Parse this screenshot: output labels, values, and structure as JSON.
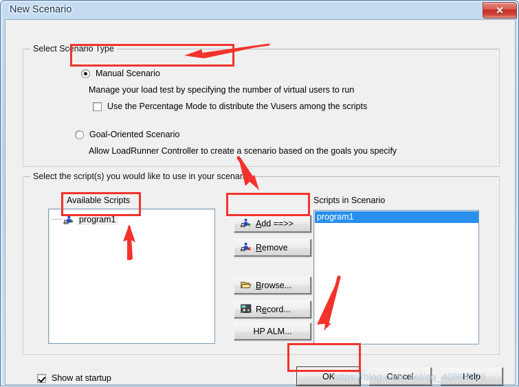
{
  "window": {
    "title": "New Scenario",
    "close_glyph": "✕",
    "close_icon_name": "close-icon"
  },
  "scenario_type": {
    "group_title": "Select Scenario Type",
    "options": [
      {
        "label": "Manual Scenario",
        "description": "Manage your load test by specifying the number of virtual users to run",
        "selected": true
      },
      {
        "label": "Goal-Oriented Scenario",
        "description": "Allow LoadRunner Controller to create a scenario based on the goals you specify",
        "selected": false
      }
    ],
    "percentage_checkbox": {
      "label": "Use the Percentage Mode to distribute the Vusers among the scripts",
      "checked": false
    }
  },
  "script_section": {
    "group_title": "Select the script(s) you would like to use in your scenario",
    "available_label": "Available Scripts",
    "scenario_label": "Scripts in Scenario",
    "available_scripts": [
      {
        "name": "program1",
        "icon": "script-icon"
      }
    ],
    "scenario_scripts": [
      {
        "name": "program1",
        "selected": true
      }
    ],
    "buttons": [
      {
        "id": "add",
        "label_pre": "",
        "accel": "A",
        "label_post": "dd ==>>",
        "icon": "add-script-icon"
      },
      {
        "id": "remove",
        "label_pre": "",
        "accel": "R",
        "label_post": "emove",
        "icon": "remove-script-icon"
      },
      {
        "id": "browse",
        "label_pre": "",
        "accel": "B",
        "label_post": "rowse...",
        "icon": "folder-open-icon"
      },
      {
        "id": "record",
        "label_pre": "R",
        "accel": "e",
        "label_post": "cord...",
        "icon": "record-icon"
      },
      {
        "id": "hpalm",
        "label_pre": "HP ALM...",
        "accel": "",
        "label_post": "",
        "icon": "none"
      }
    ]
  },
  "footer": {
    "show_at_startup": {
      "label": "Show at startup",
      "checked": true
    },
    "ok_label": "OK",
    "cancel_label": "Cancel",
    "help_label": "Help"
  },
  "annotations": {
    "highlight_color": "#f4322c",
    "watermark": "https://blog.csdn.net/qq_40666270"
  }
}
